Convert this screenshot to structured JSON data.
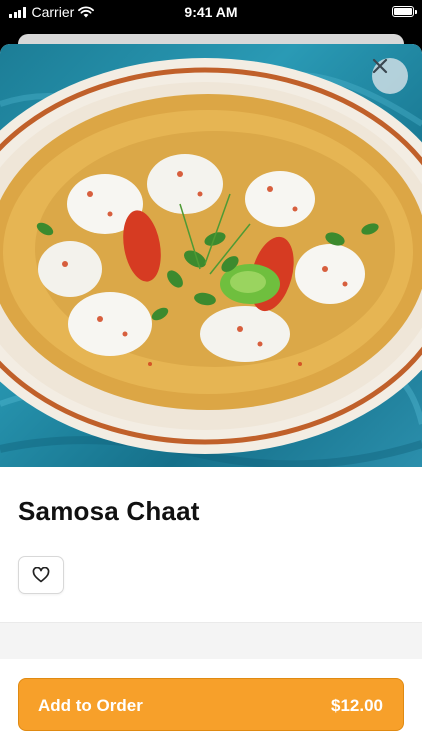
{
  "status_bar": {
    "carrier": "Carrier",
    "time": "9:41 AM"
  },
  "item": {
    "name": "Samosa Chaat"
  },
  "icons": {
    "close": "close-icon",
    "favorite": "heart-icon",
    "wifi": "wifi-icon",
    "battery": "battery-icon",
    "signal": "signal-icon"
  },
  "order": {
    "label": "Add to Order",
    "price": "$12.00"
  },
  "colors": {
    "accent": "#f7a02a",
    "accent_border": "#e08a12",
    "title": "#111111"
  }
}
